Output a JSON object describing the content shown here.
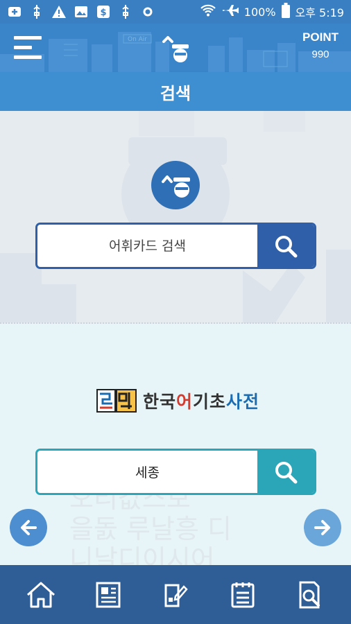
{
  "status_bar": {
    "battery": "100%",
    "time": "오후 5:19",
    "icons": [
      "plus-box-icon",
      "usb-icon",
      "warning-icon",
      "image-icon",
      "dollar-icon",
      "usb-icon",
      "settings-icon"
    ],
    "right_icons": [
      "wifi-icon",
      "airplane-icon",
      "battery-icon"
    ]
  },
  "header": {
    "menu_icon": "menu-icon",
    "logo_icon": "mascot-logo-icon",
    "point_label": "POINT",
    "point_value": "990"
  },
  "title": "검색",
  "vocab_search": {
    "placeholder": "어휘카드 검색",
    "button_icon": "search-icon",
    "mascot_icon": "mascot-icon"
  },
  "dictionary": {
    "logo_text_parts": [
      "한국",
      "어",
      "기초",
      "사전"
    ],
    "logo_icon": "dictionary-logo-icon",
    "search_value": "세종",
    "button_icon": "search-icon",
    "background_glyphs": "오리값스보\n을돐 루날흥 디\n니날디이시어"
  },
  "nav_arrows": {
    "left": "arrow-left-icon",
    "right": "arrow-right-icon"
  },
  "bottom_nav": [
    "home-icon",
    "newspaper-icon",
    "edit-note-icon",
    "list-icon",
    "search-document-icon"
  ],
  "colors": {
    "status": "#3a7fc1",
    "header": "#3a84c9",
    "titlebar": "#3d8fd1",
    "vocab_accent": "#2f5fa8",
    "dict_accent": "#2aa6b8",
    "bottom_nav": "#2f5d96"
  }
}
